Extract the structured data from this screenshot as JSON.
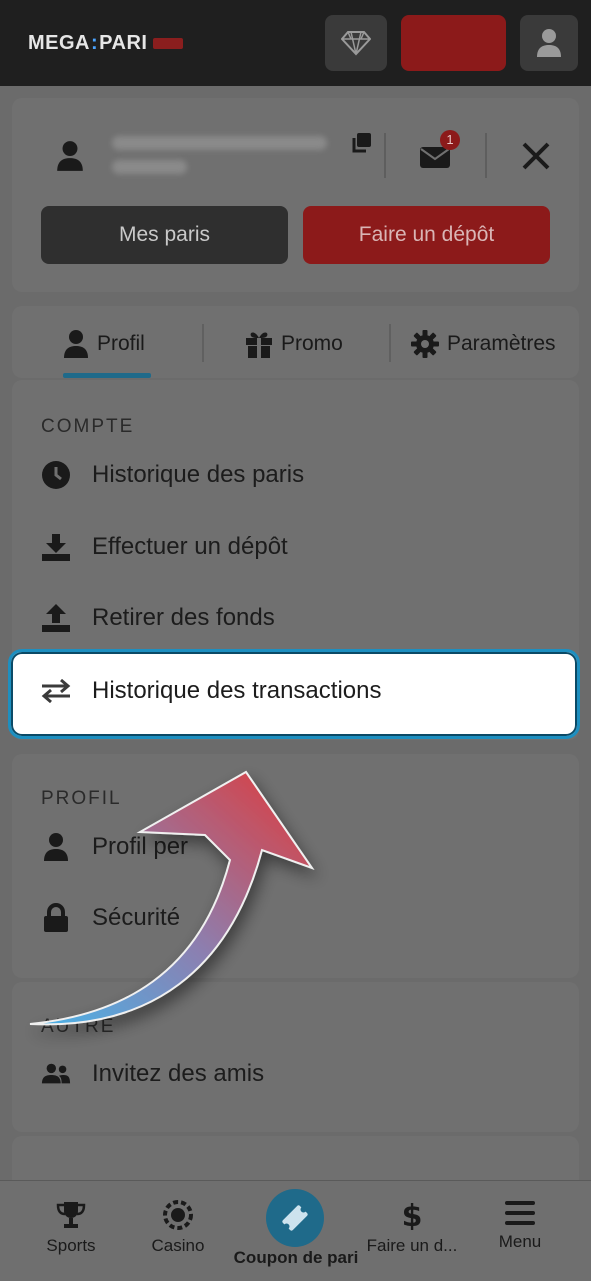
{
  "header": {
    "logo_text_left": "MEGA",
    "logo_text_right": "PARI",
    "icons": [
      "diamond-icon",
      "user-icon"
    ]
  },
  "account": {
    "notification_count": "1",
    "my_bets_label": "Mes paris",
    "deposit_label": "Faire un dépôt"
  },
  "tabs": [
    {
      "label": "Profil",
      "icon": "person-icon",
      "active": true
    },
    {
      "label": "Promo",
      "icon": "gift-icon"
    },
    {
      "label": "Paramètres",
      "icon": "gear-icon"
    }
  ],
  "sections": {
    "compte": {
      "title": "COMPTE",
      "items": [
        {
          "label": "Historique des paris",
          "icon": "clock-icon"
        },
        {
          "label": "Effectuer un dépôt",
          "icon": "download-icon"
        },
        {
          "label": "Retirer des fonds",
          "icon": "upload-icon"
        },
        {
          "label": "Historique des transactions",
          "icon": "swap-arrows-icon"
        }
      ]
    },
    "profil": {
      "title": "PROFIL",
      "items": [
        {
          "label": "Profil per",
          "icon": "person-icon"
        },
        {
          "label": "Sécurité",
          "icon": "lock-icon"
        }
      ]
    },
    "autre": {
      "title": "AUTRE",
      "items": [
        {
          "label": "Invitez des amis",
          "icon": "group-icon"
        }
      ]
    }
  },
  "bottom_nav": [
    {
      "label": "Sports",
      "icon": "trophy-icon"
    },
    {
      "label": "Casino",
      "icon": "chip-icon"
    },
    {
      "label": "Coupon de pari",
      "icon": "ticket-icon"
    },
    {
      "label": "Faire un d...",
      "icon": "dollar-icon"
    },
    {
      "label": "Menu",
      "icon": "menu-icon"
    }
  ],
  "colors": {
    "accent": "#1d8fc0",
    "brand_red": "#c8282b"
  }
}
